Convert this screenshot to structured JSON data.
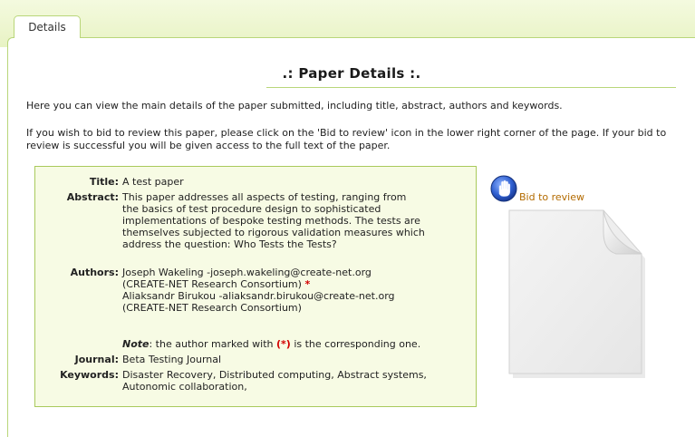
{
  "tabs": [
    {
      "label": "Details",
      "active": true
    }
  ],
  "section_title": ".: Paper Details :.",
  "intro": [
    "Here you can view the main details of the paper submitted, including title, abstract, authors and keywords.",
    "If you wish to bid to review this paper, please click on the 'Bid to review' icon in the lower right corner of the page. If your bid to review is successful you will be given access to the full text of the paper."
  ],
  "paper": {
    "title_label": "Title:",
    "title": "A test paper",
    "abstract_label": "Abstract:",
    "abstract_lines": [
      "This paper addresses all aspects of testing, ranging from",
      "the basics of test procedure design to sophisticated",
      "implementations of bespoke testing methods. The tests are",
      "themselves subjected to rigorous validation measures which",
      "address the question: Who Tests the Tests?"
    ],
    "authors_label": "Authors:",
    "authors": [
      {
        "line1": "Joseph Wakeling -joseph.wakeling@create-net.org",
        "line2": "(CREATE-NET Research Consortium)",
        "corresponding": true
      },
      {
        "line1": "Aliaksandr Birukou -aliaksandr.birukou@create-net.org",
        "line2": "(CREATE-NET Research Consortium)",
        "corresponding": false
      }
    ],
    "corresponding_marker": "*",
    "note_prefix": "Note",
    "note_mid": ": the author marked with ",
    "note_marker": "(*)",
    "note_suffix": " is the corresponding one.",
    "journal_label": "Journal:",
    "journal": "Beta Testing Journal",
    "keywords_label": "Keywords:",
    "keywords_lines": [
      "Disaster Recovery, Distributed computing, Abstract systems,",
      "Autonomic collaboration,"
    ]
  },
  "bid": {
    "label": "Bid to review",
    "icon": "hand-icon"
  },
  "document_icon": "document-icon",
  "colors": {
    "accent_green": "#b9d67a",
    "panel_bg": "#f7fbe4",
    "link_orange": "#b36b00",
    "marker_red": "#d30000"
  }
}
